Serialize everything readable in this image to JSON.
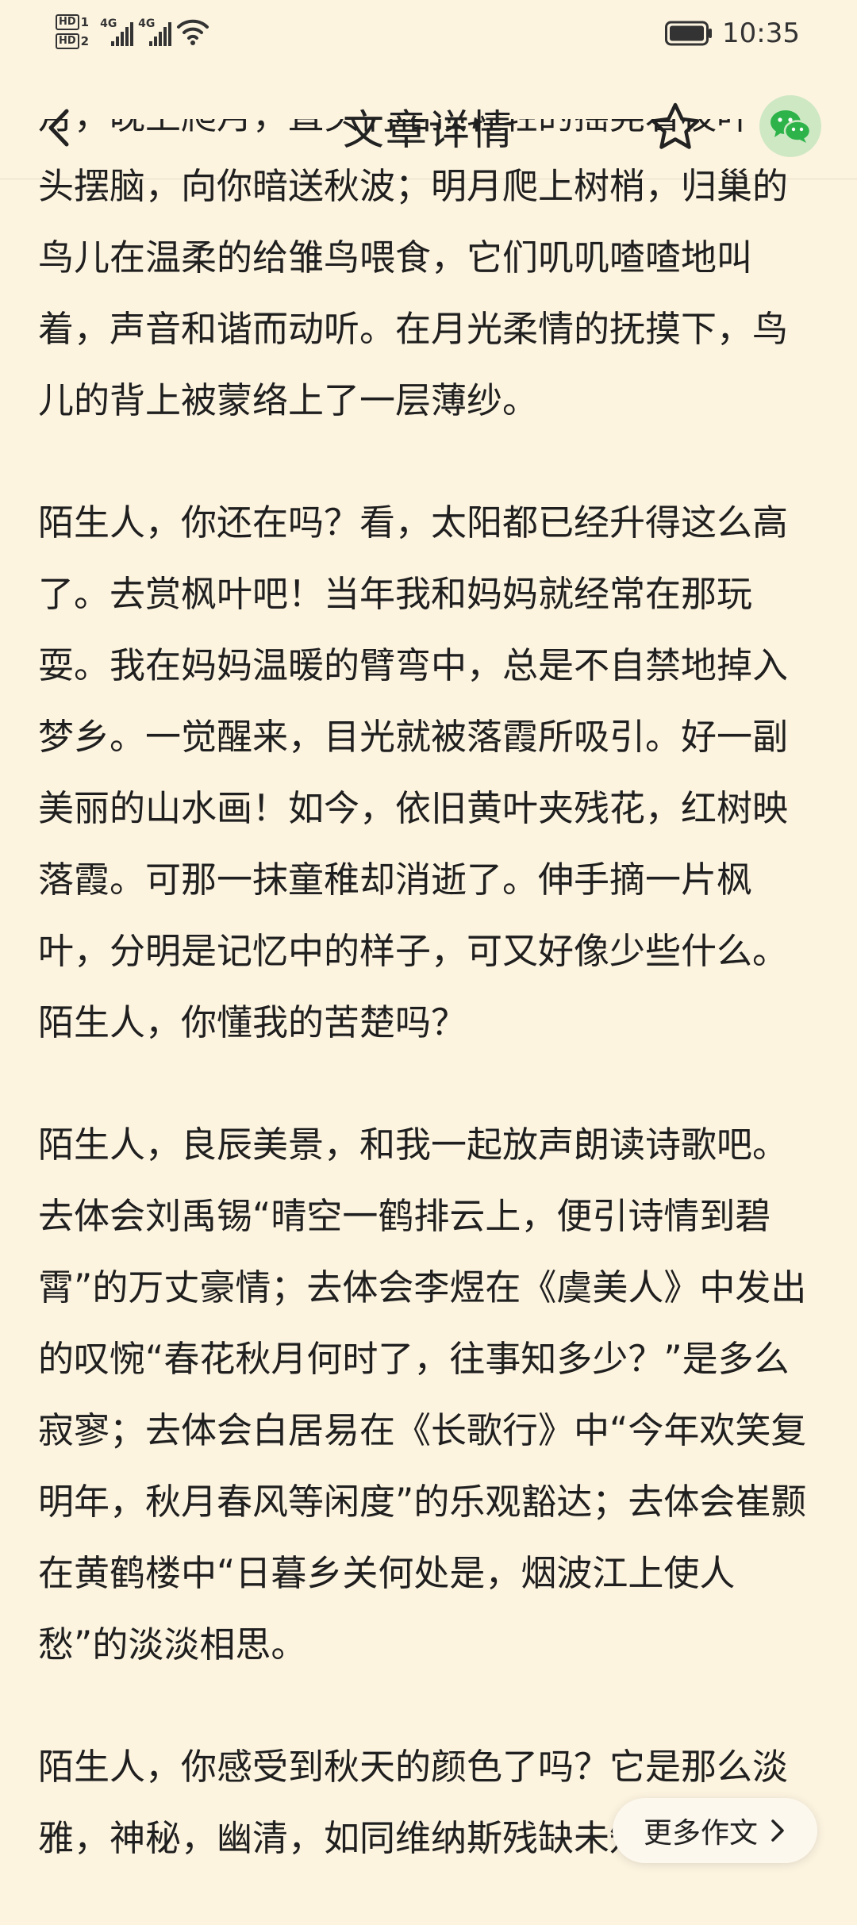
{
  "status": {
    "time": "10:35",
    "network_1": "4G",
    "network_2": "4G",
    "hd_1": "HD",
    "hd_1_sub": "1",
    "hd_2": "HD",
    "hd_2_sub": "2"
  },
  "nav": {
    "title": "文章详情"
  },
  "article": {
    "partial_line": "月，晚上爬月，直头们相顶轻轻的摇晃着枝叶",
    "paragraphs": [
      "头摆脑，向你暗送秋波；明月爬上树梢，归巢的鸟儿在温柔的给雏鸟喂食，它们叽叽喳喳地叫着，声音和谐而动听。在月光柔情的抚摸下，鸟儿的背上被蒙络上了一层薄纱。",
      "陌生人，你还在吗？看，太阳都已经升得这么高了。去赏枫叶吧！当年我和妈妈就经常在那玩耍。我在妈妈温暖的臂弯中，总是不自禁地掉入梦乡。一觉醒来，目光就被落霞所吸引。好一副美丽的山水画！如今，依旧黄叶夹残花，红树映落霞。可那一抹童稚却消逝了。伸手摘一片枫叶，分明是记忆中的样子，可又好像少些什么。陌生人，你懂我的苦楚吗？",
      "陌生人，良辰美景，和我一起放声朗读诗歌吧。去体会刘禹锡“晴空一鹤排云上，便引诗情到碧霄”的万丈豪情；去体会李煜在《虞美人》中发出的叹惋“春花秋月何时了，往事知多少？”是多么寂寥；去体会白居易在《长歌行》中“今年欢笑复明年，秋月春风等闲度”的乐观豁达；去体会崔颢在黄鹤楼中“日暮乡关何处是，烟波江上使人愁”的淡淡相思。",
      "陌生人，你感受到秋天的颜色了吗？它是那么淡雅，神秘，幽清，如同维纳斯残缺未知的双"
    ]
  },
  "more_button": {
    "label": "更多作文"
  }
}
